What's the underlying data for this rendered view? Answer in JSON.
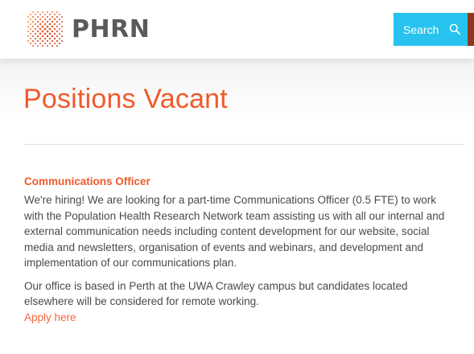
{
  "header": {
    "logo_text": "PHRN",
    "search_label": "Search"
  },
  "page": {
    "title": "Positions Vacant"
  },
  "job": {
    "title": "Communications Officer",
    "line1": "We're hiring! We are looking for a part-time Communications Officer (0.5 FTE) to work",
    "line2": "with the Population Health Research Network team assisting us with all our internal and",
    "line3": "external communication needs including content development for our website, social",
    "line4": "media and newsletters, organisation of events and webinars, and development and",
    "line5": "implementation of our communications plan.",
    "office_line1": "Our office is based in Perth at the UWA Crawley campus but candidates located",
    "office_line2": "elsewhere will be considered for remote working.",
    "apply_label": "Apply here"
  },
  "colors": {
    "accent": "#f15a2b",
    "search_bg": "#27c3ee",
    "brand_strip": "#8b3a1e",
    "text": "#4a4a4a"
  },
  "icons": {
    "logo": "australia-dots-logo-icon",
    "search": "search-icon"
  }
}
